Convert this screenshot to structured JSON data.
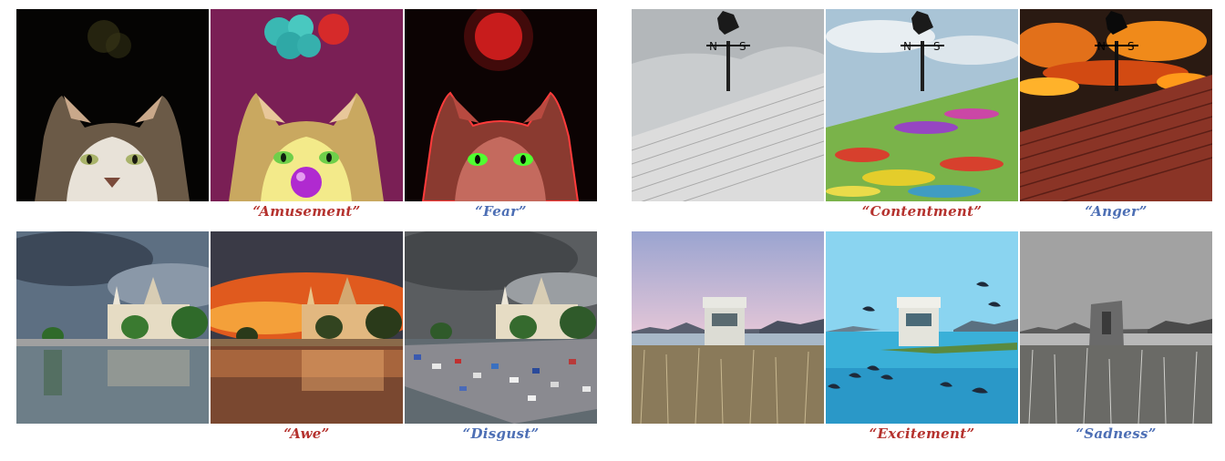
{
  "captions": {
    "cat_positive": "“Amusement”",
    "cat_negative": "“Fear”",
    "vane_positive": "“Contentment”",
    "vane_negative": "“Anger”",
    "castle_positive": "“Awe”",
    "castle_negative": "“Disgust”",
    "tower_positive": "“Excitement”",
    "tower_negative": "“Sadness”"
  },
  "colors": {
    "positive_caption": "#b5322e",
    "negative_caption": "#4d6fb5"
  },
  "panels": [
    {
      "scene": "cat",
      "variants": [
        "original",
        "amusement",
        "fear"
      ]
    },
    {
      "scene": "weathervane",
      "variants": [
        "original",
        "contentment",
        "anger"
      ]
    },
    {
      "scene": "castle",
      "variants": [
        "original",
        "awe",
        "disgust"
      ]
    },
    {
      "scene": "lake-tower",
      "variants": [
        "original",
        "excitement",
        "sadness"
      ]
    }
  ]
}
